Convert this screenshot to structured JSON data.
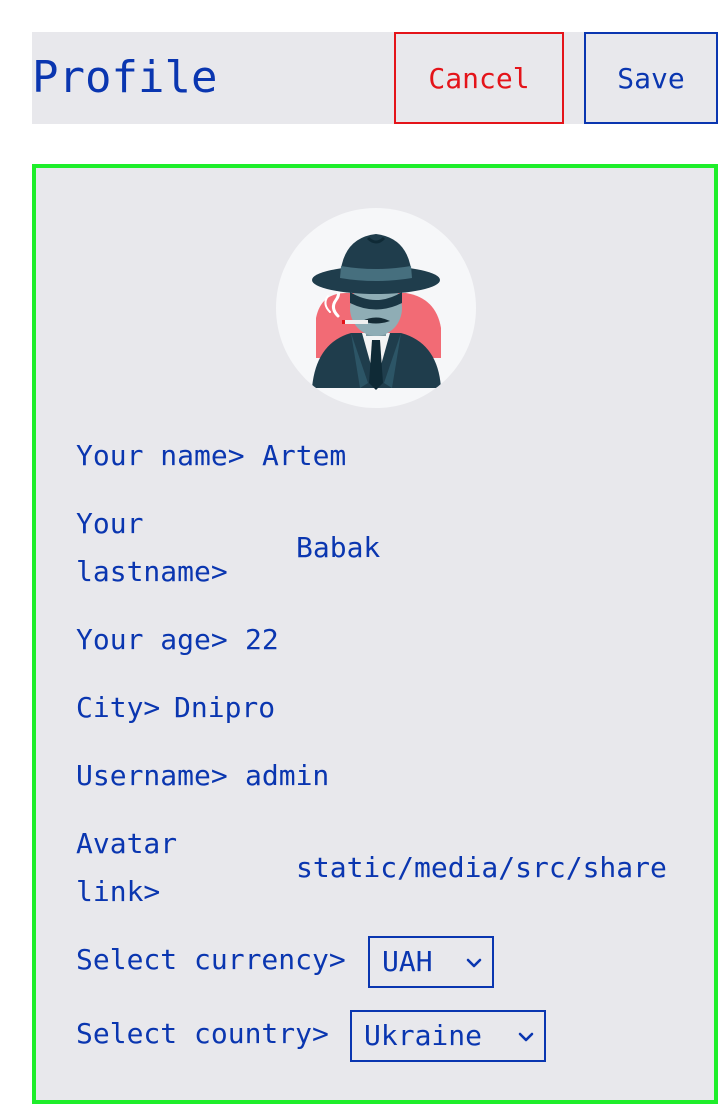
{
  "header": {
    "title": "Profile",
    "cancel_label": "Cancel",
    "save_label": "Save"
  },
  "profile": {
    "name_label": "Your name>",
    "name_value": "Artem",
    "lastname_label": "Your lastname>",
    "lastname_value": "Babak",
    "age_label": "Your age>",
    "age_value": "22",
    "city_label": "City>",
    "city_value": "Dnipro",
    "username_label": "Username>",
    "username_value": "admin",
    "avatar_label": "Avatar link>",
    "avatar_value": "static/media/src/share",
    "currency_label": "Select currency>",
    "currency_value": "UAH",
    "country_label": "Select country>",
    "country_value": "Ukraine"
  },
  "colors": {
    "text": "#0a36b0",
    "cancel": "#e4141a",
    "card_border": "#1eee2a",
    "background": "#e8e8ec"
  },
  "icons": {
    "avatar": "detective-hat-cigar-avatar",
    "select_arrow": "chevron-down-icon"
  }
}
